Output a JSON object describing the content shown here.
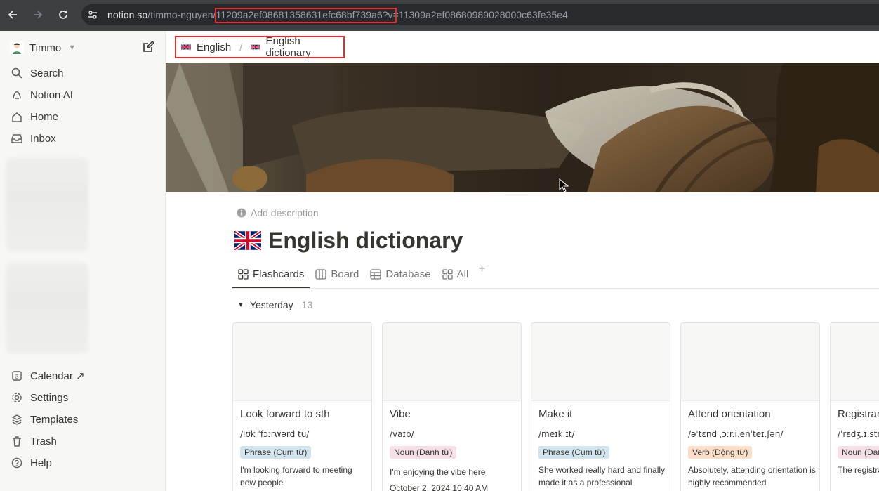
{
  "browser": {
    "url_host": "notion.so",
    "url_path": "/timmo-nguyen/11209a2ef08681358631efc68bf739a6?v=11309a2ef08680989028000c63fe35e4"
  },
  "sidebar": {
    "workspace": "Timmo",
    "items": [
      {
        "label": "Search",
        "icon": "search-icon"
      },
      {
        "label": "Notion AI",
        "icon": "notion-ai-icon"
      },
      {
        "label": "Home",
        "icon": "home-icon"
      },
      {
        "label": "Inbox",
        "icon": "inbox-icon"
      }
    ],
    "bottom_items": [
      {
        "label": "Calendar ↗",
        "icon": "calendar-icon"
      },
      {
        "label": "Settings",
        "icon": "gear-icon"
      },
      {
        "label": "Templates",
        "icon": "templates-icon"
      },
      {
        "label": "Trash",
        "icon": "trash-icon"
      },
      {
        "label": "Help",
        "icon": "help-icon"
      }
    ]
  },
  "breadcrumb": [
    "English",
    "English dictionary"
  ],
  "page": {
    "add_description": "Add description",
    "title": "English dictionary"
  },
  "tabs": [
    {
      "label": "Flashcards",
      "active": true
    },
    {
      "label": "Board",
      "active": false
    },
    {
      "label": "Database",
      "active": false
    },
    {
      "label": "All",
      "active": false
    }
  ],
  "group": {
    "label": "Yesterday",
    "count": "13"
  },
  "cards": [
    {
      "name": "Look forward to sth",
      "ipa": "/lʊk ˈfɔːrwərd tu/",
      "tag": "Phrase (Cụm từ)",
      "tag_color": "blue",
      "example": "I'm looking forward to meeting new people",
      "date": ""
    },
    {
      "name": "Vibe",
      "ipa": "/vaɪb/",
      "tag": "Noun (Danh từ)",
      "tag_color": "pink",
      "example": "I'm enjoying the vibe here",
      "date": "October 2, 2024 10:40 AM"
    },
    {
      "name": "Make it",
      "ipa": "/meɪk ɪt/",
      "tag": "Phrase (Cụm từ)",
      "tag_color": "blue",
      "example": "She worked really hard and finally made it as a professional",
      "date": ""
    },
    {
      "name": "Attend orientation",
      "ipa": "/əˈtɛnd ˌɔːr.i.enˈteɪ.ʃən/",
      "tag": "Verb (Động từ)",
      "tag_color": "orange",
      "example": "Absolutely, attending orientation is highly recommended",
      "date": ""
    },
    {
      "name": "Registrar",
      "ipa": "/ˈrɛdʒ.ɪ.strɑːr/",
      "tag": "Noun (Danh từ)",
      "tag_color": "pink",
      "example": "The registrar helped me",
      "date": ""
    }
  ],
  "colors": {
    "highlight": "#e03131",
    "sidebar_bg": "#f7f7f5",
    "text": "#37352f"
  }
}
